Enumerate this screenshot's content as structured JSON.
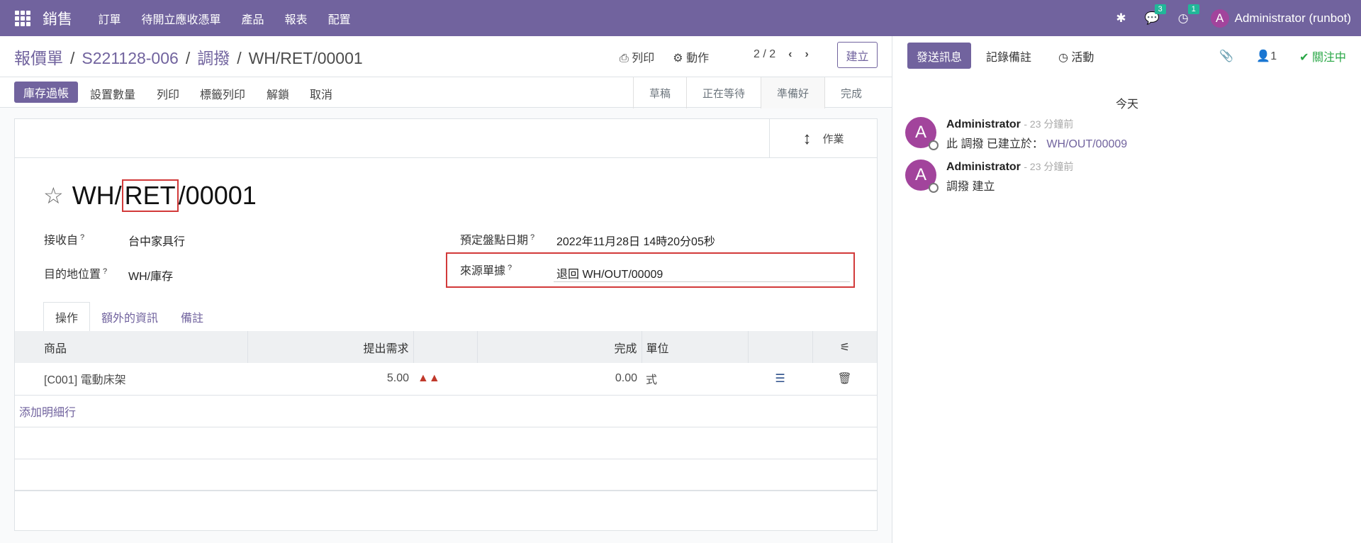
{
  "nav": {
    "brand": "銷售",
    "menu": [
      "訂單",
      "待開立應收憑單",
      "產品",
      "報表",
      "配置"
    ],
    "messages_count": "3",
    "activities_count": "1",
    "user_initial": "A",
    "user_name": "Administrator (runbot)"
  },
  "breadcrumb": {
    "items": [
      "報價單",
      "S221128-006",
      "調撥"
    ],
    "current": "WH/RET/00001"
  },
  "toolbar": {
    "print": "列印",
    "action": "動作",
    "pager": "2 / 2",
    "create": "建立"
  },
  "statusbar": {
    "buttons": [
      "庫存過帳",
      "設置數量",
      "列印",
      "標籤列印",
      "解鎖",
      "取消"
    ],
    "stages": [
      "草稿",
      "正在等待",
      "準備好",
      "完成"
    ]
  },
  "smart_button": {
    "label": "作業"
  },
  "record": {
    "title_prefix": "WH/",
    "title_highlight": "RET",
    "title_suffix": "/00001"
  },
  "fields": {
    "receive_from_label": "接收自",
    "receive_from": "台中家具行",
    "dest_label": "目的地位置",
    "dest": "WH/庫存",
    "scheduled_label": "預定盤點日期",
    "scheduled": "2022年11月28日 14時20分05秒",
    "origin_label": "來源單據",
    "origin": "退回 WH/OUT/00009",
    "help_mark": "?"
  },
  "tabs": [
    "操作",
    "額外的資訊",
    "備註"
  ],
  "lines": {
    "headers": {
      "product": "商品",
      "demand": "提出需求",
      "done": "完成",
      "uom": "單位"
    },
    "rows": [
      {
        "product": "[C001] 電動床架",
        "demand": "5.00",
        "done": "0.00",
        "uom": "式"
      }
    ],
    "add_line": "添加明細行"
  },
  "chatter": {
    "send": "發送訊息",
    "log": "記錄備註",
    "activity": "活動",
    "followers": "1",
    "follow": "關注中",
    "today": "今天",
    "messages": [
      {
        "initial": "A",
        "author": "Administrator",
        "time": "- 23 分鐘前",
        "text": "此 調撥 已建立於：",
        "link": "WH/OUT/00009"
      },
      {
        "initial": "A",
        "author": "Administrator",
        "time": "- 23 分鐘前",
        "text": "調撥 建立",
        "link": ""
      }
    ]
  },
  "colors": {
    "brand": "#71639e",
    "highlight": "#d23a3a",
    "follow": "#28a745"
  }
}
